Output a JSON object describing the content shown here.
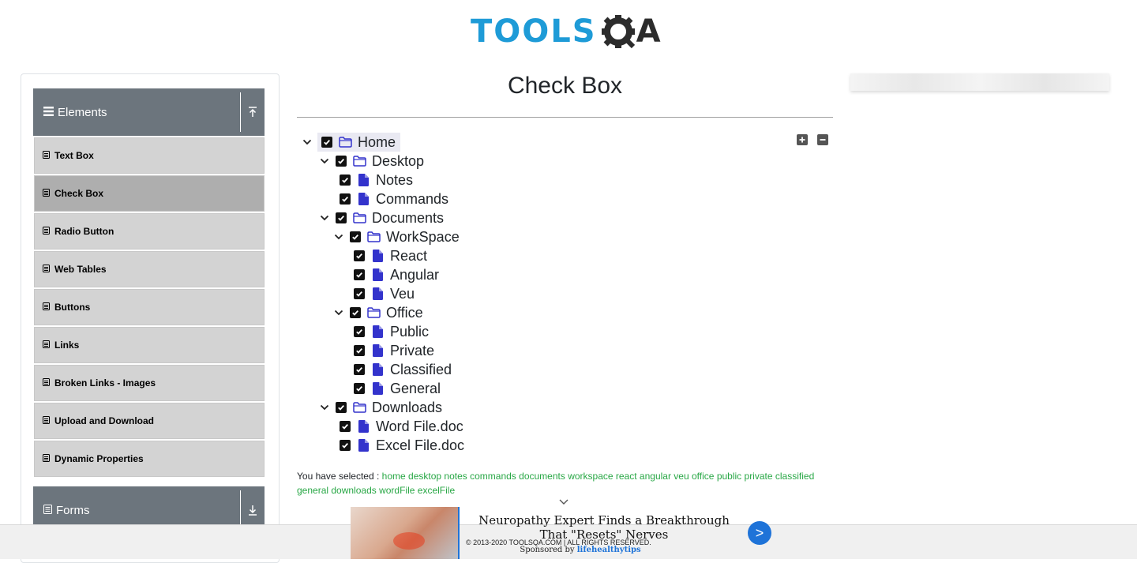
{
  "header": {
    "logo_text_1": "TOOLS",
    "logo_text_2": "A"
  },
  "sidebar": {
    "groups": [
      {
        "label": "Elements",
        "icon": "hamburger-icon",
        "toggle_icon": "arrow-up-icon"
      },
      {
        "label": "Forms",
        "icon": "list-icon",
        "toggle_icon": "arrow-down-icon"
      }
    ],
    "items": [
      {
        "label": "Text Box"
      },
      {
        "label": "Check Box",
        "active": true
      },
      {
        "label": "Radio Button"
      },
      {
        "label": "Web Tables"
      },
      {
        "label": "Buttons"
      },
      {
        "label": "Links"
      },
      {
        "label": "Broken Links - Images"
      },
      {
        "label": "Upload and Download"
      },
      {
        "label": "Dynamic Properties"
      }
    ]
  },
  "main": {
    "title": "Check Box",
    "tree": [
      {
        "label": "Home",
        "level": 0,
        "type": "folder",
        "expanded": true,
        "checked": true
      },
      {
        "label": "Desktop",
        "level": 1,
        "type": "folder",
        "expanded": true,
        "checked": true
      },
      {
        "label": "Notes",
        "level": 2,
        "type": "file",
        "checked": true
      },
      {
        "label": "Commands",
        "level": 2,
        "type": "file",
        "checked": true
      },
      {
        "label": "Documents",
        "level": 1,
        "type": "folder",
        "expanded": true,
        "checked": true
      },
      {
        "label": "WorkSpace",
        "level": 2,
        "type": "folder",
        "expanded": true,
        "checked": true
      },
      {
        "label": "React",
        "level": 3,
        "type": "file",
        "checked": true
      },
      {
        "label": "Angular",
        "level": 3,
        "type": "file",
        "checked": true
      },
      {
        "label": "Veu",
        "level": 3,
        "type": "file",
        "checked": true
      },
      {
        "label": "Office",
        "level": 2,
        "type": "folder",
        "expanded": true,
        "checked": true
      },
      {
        "label": "Public",
        "level": 3,
        "type": "file",
        "checked": true
      },
      {
        "label": "Private",
        "level": 3,
        "type": "file",
        "checked": true
      },
      {
        "label": "Classified",
        "level": 3,
        "type": "file",
        "checked": true
      },
      {
        "label": "General",
        "level": 3,
        "type": "file",
        "checked": true
      },
      {
        "label": "Downloads",
        "level": 1,
        "type": "folder",
        "expanded": true,
        "checked": true
      },
      {
        "label": "Word File.doc",
        "level": 2,
        "type": "file",
        "checked": true
      },
      {
        "label": "Excel File.doc",
        "level": 2,
        "type": "file",
        "checked": true
      }
    ],
    "result_label": "You have selected :",
    "selected": [
      "home",
      "desktop",
      "notes",
      "commands",
      "documents",
      "workspace",
      "react",
      "angular",
      "veu",
      "office",
      "public",
      "private",
      "classified",
      "general",
      "downloads",
      "wordFile",
      "excelFile"
    ]
  },
  "footer": {
    "copyright": "© 2013-2020 TOOLSQA.COM | ALL RIGHTS RESERVED."
  },
  "ad": {
    "headline": "Neuropathy Expert Finds a Breakthrough That \"Resets\" Nerves",
    "sponsored_prefix": "Sponsored by",
    "sponsor": "lifehealthytips",
    "cta": ">"
  },
  "colors": {
    "accent_blue": "#1e9bd7",
    "sidebar_header": "#6c757d",
    "menu_item": "#d3d3d3",
    "menu_item_active": "#aeaeae",
    "selected_text": "#28a745",
    "tree_icon": "#3333cc"
  }
}
